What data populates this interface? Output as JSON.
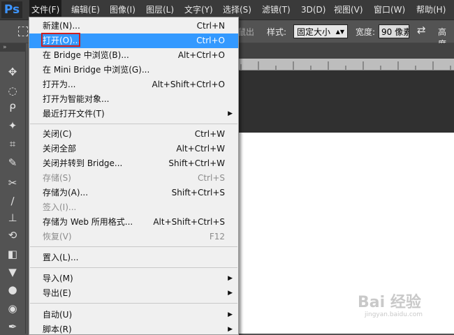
{
  "app": {
    "logo": "Ps"
  },
  "menubar": {
    "items": [
      "文件(F)",
      "编辑(E)",
      "图像(I)",
      "图层(L)",
      "文字(Y)",
      "选择(S)",
      "滤镜(T)",
      "3D(D)",
      "视图(V)",
      "窗口(W)",
      "帮助(H)"
    ],
    "active": "文件(F)"
  },
  "options_bar": {
    "partial_label": "鼠出",
    "style_label": "样式:",
    "style_value": "固定大小",
    "width_label": "宽度:",
    "width_value": "90 像素",
    "height_label": "高度"
  },
  "file_menu": {
    "items": [
      {
        "label": "新建(N)...",
        "shortcut": "Ctrl+N"
      },
      {
        "label": "打开(O)...",
        "shortcut": "Ctrl+O",
        "highlighted": true
      },
      {
        "label": "在 Bridge 中浏览(B)...",
        "shortcut": "Alt+Ctrl+O"
      },
      {
        "label": "在 Mini Bridge 中浏览(G)...",
        "shortcut": ""
      },
      {
        "label": "打开为...",
        "shortcut": "Alt+Shift+Ctrl+O"
      },
      {
        "label": "打开为智能对象...",
        "shortcut": ""
      },
      {
        "label": "最近打开文件(T)",
        "shortcut": "",
        "submenu": true
      },
      {
        "label": "关闭(C)",
        "shortcut": "Ctrl+W"
      },
      {
        "label": "关闭全部",
        "shortcut": "Alt+Ctrl+W"
      },
      {
        "label": "关闭并转到 Bridge...",
        "shortcut": "Shift+Ctrl+W"
      },
      {
        "label": "存储(S)",
        "shortcut": "Ctrl+S",
        "disabled": true
      },
      {
        "label": "存储为(A)...",
        "shortcut": "Shift+Ctrl+S"
      },
      {
        "label": "签入(I)...",
        "shortcut": "",
        "disabled": true
      },
      {
        "label": "存储为 Web 所用格式...",
        "shortcut": "Alt+Shift+Ctrl+S"
      },
      {
        "label": "恢复(V)",
        "shortcut": "F12",
        "disabled": true
      },
      {
        "label": "置入(L)...",
        "shortcut": ""
      },
      {
        "label": "导入(M)",
        "shortcut": "",
        "submenu": true
      },
      {
        "label": "导出(E)",
        "shortcut": "",
        "submenu": true
      },
      {
        "label": "自动(U)",
        "shortcut": "",
        "submenu": true
      },
      {
        "label": "脚本(R)",
        "shortcut": "",
        "submenu": true
      }
    ]
  },
  "tools": [
    "move-tool-icon",
    "marquee-tool-icon",
    "lasso-tool-icon",
    "magic-wand-icon",
    "crop-tool-icon",
    "eyedropper-icon",
    "healing-brush-icon",
    "brush-tool-icon",
    "clone-stamp-icon",
    "history-brush-icon",
    "eraser-icon",
    "paint-bucket-icon",
    "blur-tool-icon",
    "dodge-tool-icon",
    "pen-tool-icon"
  ],
  "watermark": {
    "text": "Bai 经验",
    "sub": "jingyan.baidu.com"
  }
}
